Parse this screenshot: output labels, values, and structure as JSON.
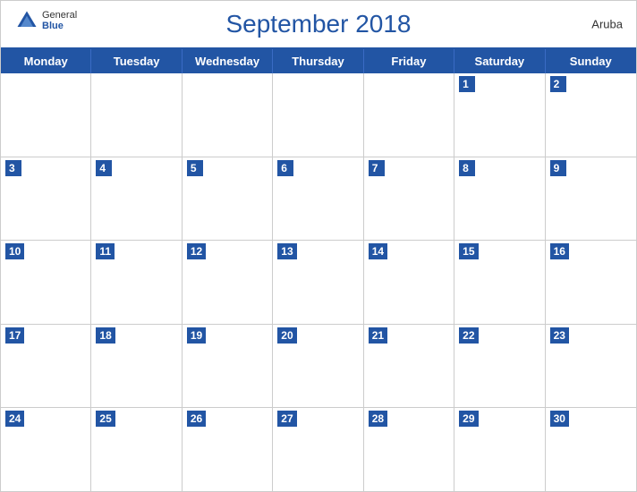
{
  "header": {
    "title": "September 2018",
    "country": "Aruba",
    "logo": {
      "general": "General",
      "blue": "Blue"
    }
  },
  "days": {
    "headers": [
      "Monday",
      "Tuesday",
      "Wednesday",
      "Thursday",
      "Friday",
      "Saturday",
      "Sunday"
    ]
  },
  "weeks": [
    [
      {
        "num": "",
        "empty": true
      },
      {
        "num": "",
        "empty": true
      },
      {
        "num": "",
        "empty": true
      },
      {
        "num": "",
        "empty": true
      },
      {
        "num": "",
        "empty": true
      },
      {
        "num": "1"
      },
      {
        "num": "2"
      }
    ],
    [
      {
        "num": "3"
      },
      {
        "num": "4"
      },
      {
        "num": "5"
      },
      {
        "num": "6"
      },
      {
        "num": "7"
      },
      {
        "num": "8"
      },
      {
        "num": "9"
      }
    ],
    [
      {
        "num": "10"
      },
      {
        "num": "11"
      },
      {
        "num": "12"
      },
      {
        "num": "13"
      },
      {
        "num": "14"
      },
      {
        "num": "15"
      },
      {
        "num": "16"
      }
    ],
    [
      {
        "num": "17"
      },
      {
        "num": "18"
      },
      {
        "num": "19"
      },
      {
        "num": "20"
      },
      {
        "num": "21"
      },
      {
        "num": "22"
      },
      {
        "num": "23"
      }
    ],
    [
      {
        "num": "24"
      },
      {
        "num": "25"
      },
      {
        "num": "26"
      },
      {
        "num": "27"
      },
      {
        "num": "28"
      },
      {
        "num": "29"
      },
      {
        "num": "30"
      }
    ]
  ]
}
